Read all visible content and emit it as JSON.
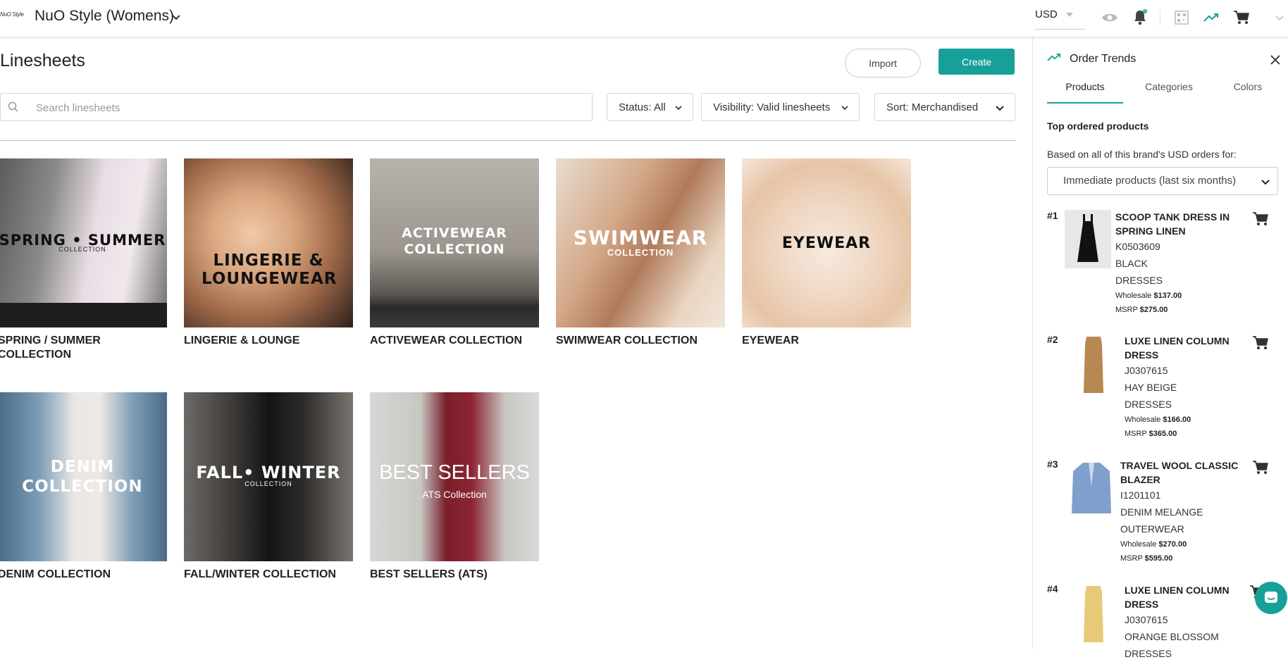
{
  "topbar": {
    "logo_text": "NuO Style",
    "brand_name": "NuO Style (Womens)",
    "currency": "USD",
    "icons": [
      "chevron-down-icon",
      "eye-icon",
      "bell-icon",
      "barcode-icon",
      "trend-icon",
      "cart-icon"
    ],
    "accent_color": "#17a09a"
  },
  "main": {
    "title": "Linesheets",
    "import_label": "Import",
    "create_label": "Create",
    "search_placeholder": "Search linesheets",
    "filters": {
      "status": "Status: All",
      "visibility": "Visibility: Valid linesheets",
      "sort": "Sort: Merchandised"
    },
    "linesheets": [
      {
        "label": "SPRING / SUMMER COLLECTION",
        "overlay": "SPRING • SUMMER",
        "overlay_sub": "COLLECTION"
      },
      {
        "label": "LINGERIE & LOUNGE",
        "overlay": "LINGERIE & LOUNGEWEAR",
        "overlay_sub": ""
      },
      {
        "label": "ACTIVEWEAR COLLECTION",
        "overlay": "ACTIVEWEAR COLLECTION",
        "overlay_sub": ""
      },
      {
        "label": "SWIMWEAR COLLECTION",
        "overlay": "SWIMWEAR",
        "overlay_sub": "COLLECTION"
      },
      {
        "label": "EYEWEAR",
        "overlay": "EYEWEAR",
        "overlay_sub": ""
      },
      {
        "label": "DENIM COLLECTION",
        "overlay": "DENIM COLLECTION",
        "overlay_sub": ""
      },
      {
        "label": "FALL/WINTER COLLECTION",
        "overlay": "FALL• WINTER",
        "overlay_sub": "COLLECTION"
      },
      {
        "label": "BEST SELLERS (ATS)",
        "overlay": "BEST SELLERS",
        "overlay_sub": "ATS Collection"
      }
    ]
  },
  "sidebar": {
    "title": "Order Trends",
    "tabs": [
      "Products",
      "Categories",
      "Colors"
    ],
    "active_tab": "Products",
    "section_title": "Top ordered products",
    "based_on": "Based on all of this brand's USD orders for:",
    "period": "Immediate products (last six months)",
    "products": [
      {
        "rank": "#1",
        "name": "SCOOP TANK DRESS IN SPRING LINEN",
        "sku": "K0503609",
        "color": "BLACK",
        "category": "DRESSES",
        "wholesale_label": "Wholesale",
        "wholesale": "$137.00",
        "msrp_label": "MSRP",
        "msrp": "$275.00"
      },
      {
        "rank": "#2",
        "name": "LUXE LINEN COLUMN DRESS",
        "sku": "J0307615",
        "color": "HAY BEIGE",
        "category": "DRESSES",
        "wholesale_label": "Wholesale",
        "wholesale": "$166.00",
        "msrp_label": "MSRP",
        "msrp": "$365.00"
      },
      {
        "rank": "#3",
        "name": "TRAVEL WOOL CLASSIC BLAZER",
        "sku": "I1201101",
        "color": "DENIM MELANGE",
        "category": "OUTERWEAR",
        "wholesale_label": "Wholesale",
        "wholesale": "$270.00",
        "msrp_label": "MSRP",
        "msrp": "$595.00"
      },
      {
        "rank": "#4",
        "name": "LUXE LINEN COLUMN DRESS",
        "sku": "J0307615",
        "color": "ORANGE BLOSSOM",
        "category": "DRESSES"
      }
    ]
  }
}
